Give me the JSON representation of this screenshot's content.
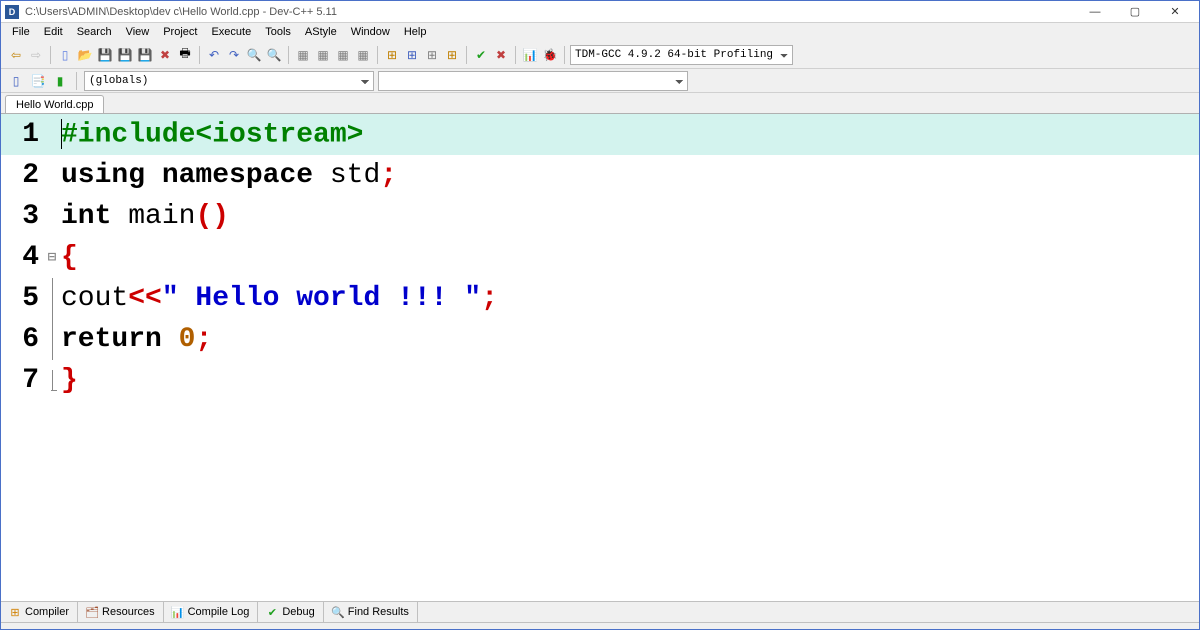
{
  "titlebar": {
    "path": "C:\\Users\\ADMIN\\Desktop\\dev c\\Hello World.cpp - Dev-C++ 5.11"
  },
  "menu": [
    "File",
    "Edit",
    "Search",
    "View",
    "Project",
    "Execute",
    "Tools",
    "AStyle",
    "Window",
    "Help"
  ],
  "toolbar": {
    "compiler_selector": "TDM-GCC 4.9.2 64-bit Profiling"
  },
  "toolbar2": {
    "scope_selector": "(globals)"
  },
  "file_tab": "Hello World.cpp",
  "code": {
    "lines": [
      {
        "n": "1",
        "hl": true,
        "tokens": [
          {
            "c": "tok-pre",
            "t": "#include<iostream>"
          }
        ]
      },
      {
        "n": "2",
        "tokens": [
          {
            "c": "tok-kw",
            "t": "using "
          },
          {
            "c": "tok-kw",
            "t": "namespace "
          },
          {
            "c": "tok-id",
            "t": "std"
          },
          {
            "c": "tok-semi",
            "t": ";"
          }
        ]
      },
      {
        "n": "3",
        "tokens": [
          {
            "c": "tok-kw",
            "t": "int "
          },
          {
            "c": "tok-id",
            "t": "main"
          },
          {
            "c": "tok-pun-red",
            "t": "()"
          }
        ]
      },
      {
        "n": "4",
        "fold": "⊟",
        "tokens": [
          {
            "c": "tok-brace",
            "t": "{"
          }
        ]
      },
      {
        "n": "5",
        "bar": true,
        "tokens": [
          {
            "c": "tok-id",
            "t": "cout"
          },
          {
            "c": "tok-op",
            "t": "<<"
          },
          {
            "c": "tok-str",
            "t": "\" Hello world !!! \""
          },
          {
            "c": "tok-semi",
            "t": ";"
          }
        ]
      },
      {
        "n": "6",
        "bar": true,
        "tokens": [
          {
            "c": "tok-kw",
            "t": "return "
          },
          {
            "c": "tok-num",
            "t": "0"
          },
          {
            "c": "tok-semi",
            "t": ";"
          }
        ]
      },
      {
        "n": "7",
        "barend": true,
        "tokens": [
          {
            "c": "tok-brace",
            "t": "}"
          }
        ]
      }
    ]
  },
  "bottom_tabs": [
    {
      "icon": "⊞",
      "color": "#d08000",
      "label": "Compiler"
    },
    {
      "icon": "🗂",
      "color": "#a05030",
      "label": "Resources"
    },
    {
      "icon": "📊",
      "color": "#2060c0",
      "label": "Compile Log"
    },
    {
      "icon": "✔",
      "color": "#20a020",
      "label": "Debug"
    },
    {
      "icon": "🔍",
      "color": "#606060",
      "label": "Find Results"
    }
  ]
}
